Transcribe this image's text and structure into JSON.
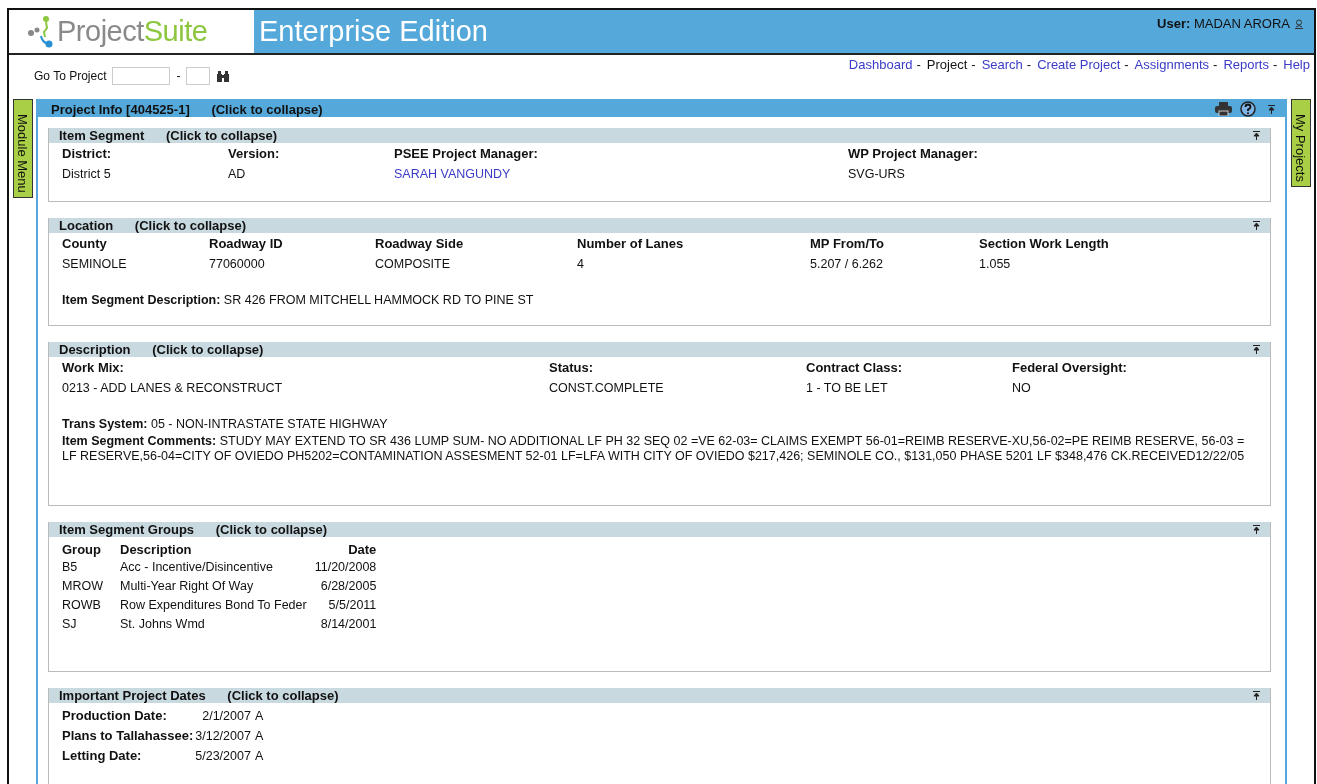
{
  "header": {
    "brand_first": "Project",
    "brand_second": "Suite",
    "edition": "Enterprise Edition",
    "user_label": "User:",
    "user_name": "MADAN ARORA"
  },
  "goto": {
    "label": "Go To Project",
    "separator": "-"
  },
  "nav": [
    {
      "label": "Dashboard",
      "selected": false
    },
    {
      "label": "Project",
      "selected": true
    },
    {
      "label": "Search",
      "selected": false
    },
    {
      "label": "Create Project",
      "selected": false
    },
    {
      "label": "Assignments",
      "selected": false
    },
    {
      "label": "Reports",
      "selected": false
    },
    {
      "label": "Help",
      "selected": false
    }
  ],
  "nav_separator": "-",
  "side_tabs": {
    "left": "Module Menu",
    "right": "My Projects"
  },
  "panel": {
    "title": "Project Info [404525-1]",
    "hint": "(Click to collapse)"
  },
  "sections": [
    {
      "kind": "fields",
      "title": "Item Segment",
      "hint": "(Click to collapse)",
      "columns": [
        {
          "label": "District:",
          "value": "District 5",
          "link": false
        },
        {
          "label": "Version:",
          "value": "AD",
          "link": false
        },
        {
          "label": "PSEE Project Manager:",
          "value": "SARAH VANGUNDY",
          "link": true
        },
        {
          "label": "WP Project Manager:",
          "value": "SVG-URS",
          "link": false
        }
      ]
    },
    {
      "kind": "fields",
      "title": "Location",
      "hint": "(Click to collapse)",
      "columns": [
        {
          "label": "County",
          "value": "SEMINOLE",
          "link": false
        },
        {
          "label": "Roadway ID",
          "value": "77060000",
          "link": false
        },
        {
          "label": "Roadway Side",
          "value": "COMPOSITE",
          "link": false
        },
        {
          "label": "Number of Lanes",
          "value": "4",
          "link": false
        },
        {
          "label": "MP From/To",
          "value": "5.207 / 6.262",
          "link": false
        },
        {
          "label": "Section Work Length",
          "value": "1.055",
          "link": false
        }
      ],
      "lines": [
        {
          "label": "Item Segment Description:",
          "value": "SR 426 FROM MITCHELL HAMMOCK RD TO PINE ST"
        }
      ]
    },
    {
      "kind": "fields",
      "title": "Description",
      "hint": "(Click to collapse)",
      "columns": [
        {
          "label": "Work Mix:",
          "value": "0213 - ADD LANES & RECONSTRUCT",
          "link": false
        },
        {
          "label": "Status:",
          "value": "CONST.COMPLETE",
          "link": false
        },
        {
          "label": "Contract Class:",
          "value": "1 - TO BE LET",
          "link": false
        },
        {
          "label": "Federal Oversight:",
          "value": "NO",
          "link": false
        }
      ],
      "lines": [
        {
          "label": "Trans System:",
          "value": "05 - NON-INTRASTATE STATE HIGHWAY"
        },
        {
          "label": "Item Segment Comments:",
          "value": "STUDY MAY EXTEND TO SR 436 LUMP SUM- NO ADDITIONAL LF PH 32 SEQ 02 =VE 62-03= CLAIMS EXEMPT 56-01=REIMB RESERVE-XU,56-02=PE REIMB RESERVE, 56-03 = LF RESERVE,56-04=CITY OF OVIEDO PH5202=CONTAMINATION ASSESMENT 52-01 LF=LFA WITH CITY OF OVIEDO $217,426; SEMINOLE CO., $131,050 PHASE 5201 LF $348,476 CK.RECEIVED12/22/05"
        }
      ]
    },
    {
      "kind": "table",
      "title": "Item Segment Groups",
      "hint": "(Click to collapse)",
      "headers": [
        "Group",
        "Description",
        "Date"
      ],
      "rows": [
        [
          "B5",
          "Acc - Incentive/Disincentive",
          "11/20/2008"
        ],
        [
          "MROW",
          "Multi-Year Right Of Way",
          "6/28/2005"
        ],
        [
          "ROWB",
          "Row Expenditures Bond To Feder",
          "5/5/2011"
        ],
        [
          "SJ",
          "St. Johns Wmd",
          "8/14/2001"
        ]
      ]
    },
    {
      "kind": "dates",
      "title": "Important Project Dates",
      "hint": "(Click to collapse)",
      "dates": [
        {
          "label": "Production Date:",
          "date": "2/1/2007",
          "flag": "A"
        },
        {
          "label": "Plans to Tallahassee:",
          "date": "3/12/2007",
          "flag": "A"
        },
        {
          "label": "Letting Date:",
          "date": "5/23/2007",
          "flag": "A"
        }
      ]
    }
  ]
}
